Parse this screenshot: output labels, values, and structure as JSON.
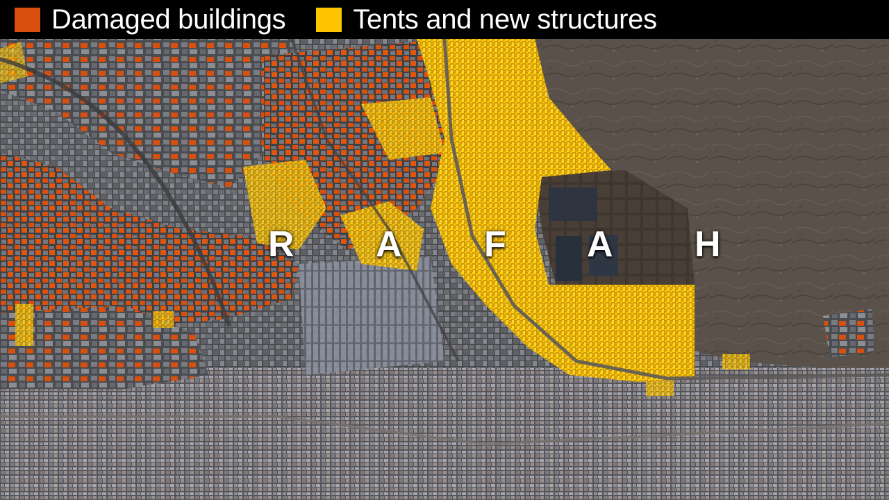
{
  "legend": {
    "items": [
      {
        "label": "Damaged buildings",
        "color": "#d9500e"
      },
      {
        "label": "Tents and new structures",
        "color": "#ffc400"
      }
    ]
  },
  "place_label": {
    "letters": [
      "R",
      "A",
      "F",
      "A",
      "H"
    ]
  },
  "colors": {
    "damaged": "#d9500e",
    "tents": "#ffc400",
    "urban_gray": "#6c6e73",
    "terrain": "#5e554d",
    "legend_background": "#000000"
  }
}
